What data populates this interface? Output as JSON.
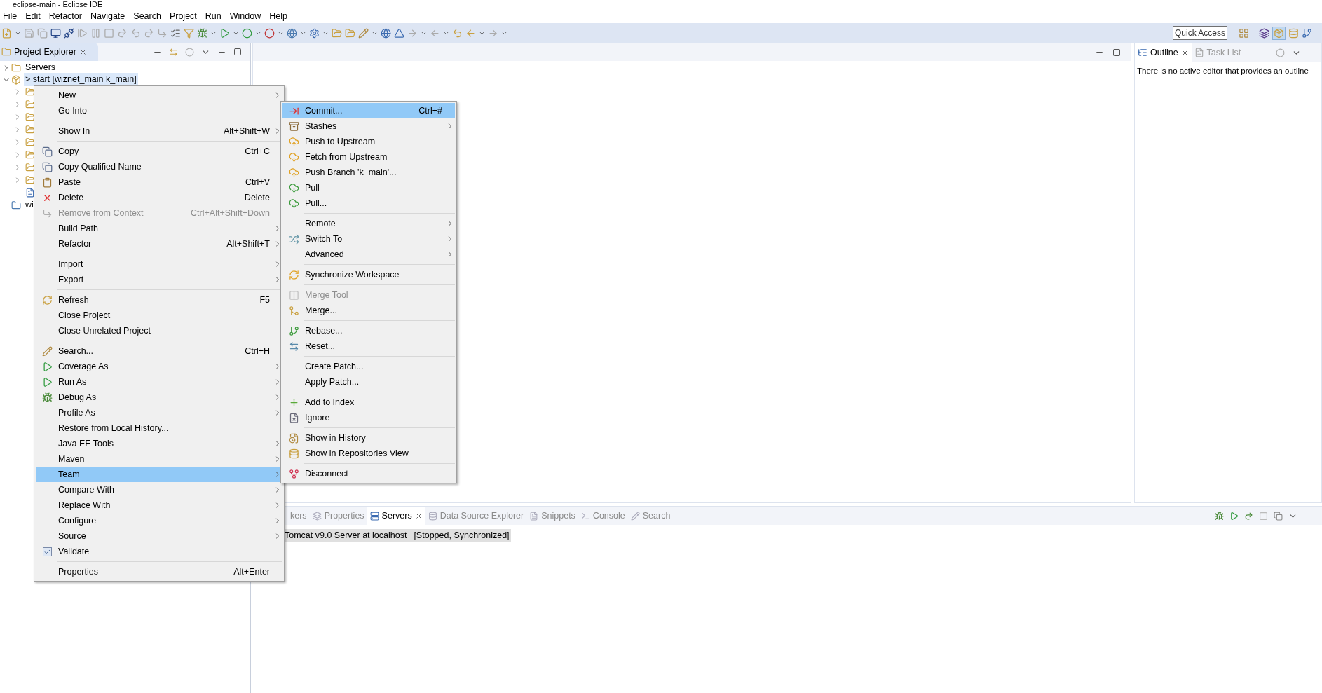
{
  "window": {
    "title": "eclipse-main - Eclipse IDE"
  },
  "menu_bar": [
    "File",
    "Edit",
    "Refactor",
    "Navigate",
    "Search",
    "Project",
    "Run",
    "Window",
    "Help"
  ],
  "quick_access": {
    "placeholder": "Quick Access"
  },
  "project_explorer": {
    "title": "Project Explorer",
    "items": [
      {
        "label": "Servers",
        "expanded": false,
        "selected": false
      },
      {
        "label": "> start [wiznet_main k_main]",
        "expanded": true,
        "selected": true,
        "children": [
          {
            "kind": "folder",
            "expanded": false
          },
          {
            "kind": "folder",
            "expanded": false
          },
          {
            "kind": "folder",
            "expanded": false
          },
          {
            "kind": "folder",
            "expanded": false
          },
          {
            "kind": "folder",
            "expanded": false
          },
          {
            "kind": "folder",
            "expanded": false
          },
          {
            "kind": "folder",
            "expanded": false
          },
          {
            "kind": "folder",
            "expanded": false
          },
          {
            "kind": "file"
          }
        ]
      },
      {
        "label": "wi",
        "expanded": false,
        "selected": false
      }
    ]
  },
  "outline": {
    "tabs": [
      {
        "label": "Outline",
        "selected": true
      },
      {
        "label": "Task List",
        "selected": false
      }
    ],
    "message": "There is no active editor that provides an outline"
  },
  "bottom_panel": {
    "tabs": [
      {
        "label": "kers",
        "selected": false
      },
      {
        "label": "Properties",
        "selected": false
      },
      {
        "label": "Servers",
        "selected": true
      },
      {
        "label": "Data Source Explorer",
        "selected": false
      },
      {
        "label": "Snippets",
        "selected": false
      },
      {
        "label": "Console",
        "selected": false
      },
      {
        "label": "Search",
        "selected": false
      }
    ],
    "rows": [
      {
        "name": "Tomcat v9.0 Server at localhost",
        "status": "[Stopped, Synchronized]",
        "selected": true
      }
    ]
  },
  "context_menu": {
    "groups": [
      [
        {
          "label": "New",
          "submenu": true,
          "disabled": false,
          "selected": false,
          "checked": false
        },
        {
          "label": "Go Into",
          "submenu": false,
          "disabled": false,
          "selected": false,
          "checked": false
        }
      ],
      [
        {
          "label": "Show In",
          "shortcut": "Alt+Shift+W",
          "submenu": true,
          "disabled": false,
          "selected": false,
          "checked": false
        }
      ],
      [
        {
          "label": "Copy",
          "shortcut": "Ctrl+C",
          "submenu": false,
          "disabled": false,
          "selected": false,
          "checked": false
        },
        {
          "label": "Copy Qualified Name",
          "submenu": false,
          "disabled": false,
          "selected": false,
          "checked": false
        },
        {
          "label": "Paste",
          "shortcut": "Ctrl+V",
          "submenu": false,
          "disabled": false,
          "selected": false,
          "checked": false
        },
        {
          "label": "Delete",
          "shortcut": "Delete",
          "submenu": false,
          "disabled": false,
          "selected": false,
          "checked": false
        },
        {
          "label": "Remove from Context",
          "shortcut": "Ctrl+Alt+Shift+Down",
          "submenu": false,
          "disabled": true,
          "selected": false,
          "checked": false
        },
        {
          "label": "Build Path",
          "submenu": true,
          "disabled": false,
          "selected": false,
          "checked": false
        },
        {
          "label": "Refactor",
          "shortcut": "Alt+Shift+T",
          "submenu": true,
          "disabled": false,
          "selected": false,
          "checked": false
        }
      ],
      [
        {
          "label": "Import",
          "submenu": true,
          "disabled": false,
          "selected": false,
          "checked": false
        },
        {
          "label": "Export",
          "submenu": true,
          "disabled": false,
          "selected": false,
          "checked": false
        }
      ],
      [
        {
          "label": "Refresh",
          "shortcut": "F5",
          "submenu": false,
          "disabled": false,
          "selected": false,
          "checked": false
        },
        {
          "label": "Close Project",
          "submenu": false,
          "disabled": false,
          "selected": false,
          "checked": false
        },
        {
          "label": "Close Unrelated Project",
          "submenu": false,
          "disabled": false,
          "selected": false,
          "checked": false
        }
      ],
      [
        {
          "label": "Search...",
          "shortcut": "Ctrl+H",
          "submenu": false,
          "disabled": false,
          "selected": false,
          "checked": false
        },
        {
          "label": "Coverage As",
          "submenu": true,
          "disabled": false,
          "selected": false,
          "checked": false
        },
        {
          "label": "Run As",
          "submenu": true,
          "disabled": false,
          "selected": false,
          "checked": false
        },
        {
          "label": "Debug As",
          "submenu": true,
          "disabled": false,
          "selected": false,
          "checked": false
        },
        {
          "label": "Profile As",
          "submenu": true,
          "disabled": false,
          "selected": false,
          "checked": false
        },
        {
          "label": "Restore from Local History...",
          "submenu": false,
          "disabled": false,
          "selected": false,
          "checked": false
        },
        {
          "label": "Java EE Tools",
          "submenu": true,
          "disabled": false,
          "selected": false,
          "checked": false
        },
        {
          "label": "Maven",
          "submenu": true,
          "disabled": false,
          "selected": false,
          "checked": false
        },
        {
          "label": "Team",
          "submenu": true,
          "disabled": false,
          "selected": true,
          "checked": false
        },
        {
          "label": "Compare With",
          "submenu": true,
          "disabled": false,
          "selected": false,
          "checked": false
        },
        {
          "label": "Replace With",
          "submenu": true,
          "disabled": false,
          "selected": false,
          "checked": false
        },
        {
          "label": "Configure",
          "submenu": true,
          "disabled": false,
          "selected": false,
          "checked": false
        },
        {
          "label": "Source",
          "submenu": true,
          "disabled": false,
          "selected": false,
          "checked": false
        },
        {
          "label": "Validate",
          "submenu": false,
          "disabled": false,
          "selected": false,
          "checked": true
        }
      ],
      [
        {
          "label": "Properties",
          "shortcut": "Alt+Enter",
          "submenu": false,
          "disabled": false,
          "selected": false,
          "checked": false
        }
      ]
    ]
  },
  "team_menu": {
    "groups": [
      [
        {
          "label": "Commit...",
          "shortcut": "Ctrl+#",
          "submenu": false,
          "disabled": false,
          "selected": true
        },
        {
          "label": "Stashes",
          "submenu": true,
          "disabled": false,
          "selected": false
        },
        {
          "label": "Push to Upstream",
          "submenu": false,
          "disabled": false,
          "selected": false
        },
        {
          "label": "Fetch from Upstream",
          "submenu": false,
          "disabled": false,
          "selected": false
        },
        {
          "label": "Push Branch 'k_main'...",
          "submenu": false,
          "disabled": false,
          "selected": false
        },
        {
          "label": "Pull",
          "submenu": false,
          "disabled": false,
          "selected": false
        },
        {
          "label": "Pull...",
          "submenu": false,
          "disabled": false,
          "selected": false
        }
      ],
      [
        {
          "label": "Remote",
          "submenu": true,
          "disabled": false,
          "selected": false
        },
        {
          "label": "Switch To",
          "submenu": true,
          "disabled": false,
          "selected": false
        },
        {
          "label": "Advanced",
          "submenu": true,
          "disabled": false,
          "selected": false
        }
      ],
      [
        {
          "label": "Synchronize Workspace",
          "submenu": false,
          "disabled": false,
          "selected": false
        }
      ],
      [
        {
          "label": "Merge Tool",
          "submenu": false,
          "disabled": true,
          "selected": false
        },
        {
          "label": "Merge...",
          "submenu": false,
          "disabled": false,
          "selected": false
        }
      ],
      [
        {
          "label": "Rebase...",
          "submenu": false,
          "disabled": false,
          "selected": false
        },
        {
          "label": "Reset...",
          "submenu": false,
          "disabled": false,
          "selected": false
        }
      ],
      [
        {
          "label": "Create Patch...",
          "submenu": false,
          "disabled": false,
          "selected": false
        },
        {
          "label": "Apply Patch...",
          "submenu": false,
          "disabled": false,
          "selected": false
        }
      ],
      [
        {
          "label": "Add to Index",
          "submenu": false,
          "disabled": false,
          "selected": false
        },
        {
          "label": "Ignore",
          "submenu": false,
          "disabled": false,
          "selected": false
        }
      ],
      [
        {
          "label": "Show in History",
          "submenu": false,
          "disabled": false,
          "selected": false
        },
        {
          "label": "Show in Repositories View",
          "submenu": false,
          "disabled": false,
          "selected": false
        }
      ],
      [
        {
          "label": "Disconnect",
          "submenu": false,
          "disabled": false,
          "selected": false
        }
      ]
    ]
  }
}
